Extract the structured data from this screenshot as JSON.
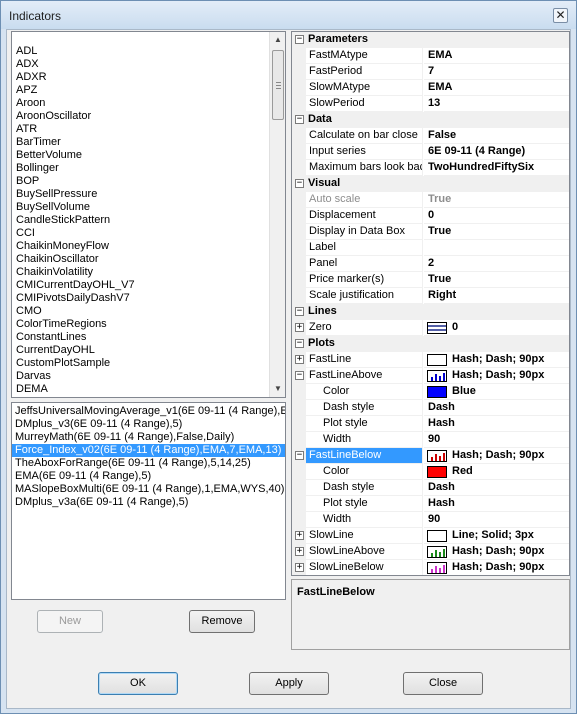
{
  "window": {
    "title": "Indicators",
    "close_glyph": "✕"
  },
  "indicators": [
    "ADL",
    "ADX",
    "ADXR",
    "APZ",
    "Aroon",
    "AroonOscillator",
    "ATR",
    "BarTimer",
    "BetterVolume",
    "Bollinger",
    "BOP",
    "BuySellPressure",
    "BuySellVolume",
    "CandleStickPattern",
    "CCI",
    "ChaikinMoneyFlow",
    "ChaikinOscillator",
    "ChaikinVolatility",
    "CMICurrentDayOHL_V7",
    "CMIPivotsDailyDashV7",
    "CMO",
    "ColorTimeRegions",
    "ConstantLines",
    "CurrentDayOHL",
    "CustomPlotSample",
    "Darvas",
    "DEMA"
  ],
  "applied": [
    "JeffsUniversalMovingAverage_v1(6E 09-11 (4 Range),E",
    "DMplus_v3(6E 09-11 (4 Range),5)",
    "MurreyMath(6E 09-11 (4 Range),False,Daily)",
    "Force_Index_v02(6E 09-11 (4 Range),EMA,7,EMA,13)",
    "TheAboxForRange(6E 09-11 (4 Range),5,14,25)",
    "EMA(6E 09-11 (4 Range),5)",
    "MASlopeBoxMulti(6E 09-11 (4 Range),1,EMA,WYS,40)",
    "DMplus_v3a(6E 09-11 (4 Range),5)"
  ],
  "applied_selected_index": 3,
  "buttons": {
    "new": "New",
    "remove": "Remove",
    "ok": "OK",
    "apply": "Apply",
    "close": "Close"
  },
  "grid": {
    "categories": {
      "parameters": "Parameters",
      "data": "Data",
      "visual": "Visual",
      "lines": "Lines",
      "plots": "Plots"
    },
    "parameters": [
      {
        "name": "FastMAtype",
        "value": "EMA"
      },
      {
        "name": "FastPeriod",
        "value": "7"
      },
      {
        "name": "SlowMAtype",
        "value": "EMA"
      },
      {
        "name": "SlowPeriod",
        "value": "13"
      }
    ],
    "data": [
      {
        "name": "Calculate on bar close",
        "value": "False"
      },
      {
        "name": "Input series",
        "value": "6E 09-11 (4 Range)"
      },
      {
        "name": "Maximum bars look bacl",
        "value": "TwoHundredFiftySix"
      }
    ],
    "visual": [
      {
        "name": "Auto scale",
        "value": "True"
      },
      {
        "name": "Displacement",
        "value": "0"
      },
      {
        "name": "Display in Data Box",
        "value": "True"
      },
      {
        "name": "Label",
        "value": ""
      },
      {
        "name": "Panel",
        "value": "2"
      },
      {
        "name": "Price marker(s)",
        "value": "True"
      },
      {
        "name": "Scale justification",
        "value": "Right"
      }
    ],
    "lines": [
      {
        "name": "Zero",
        "value": "0"
      }
    ],
    "plots": {
      "fastline": {
        "name": "FastLine",
        "value": "Hash; Dash; 90px"
      },
      "fastlineabove": {
        "name": "FastLineAbove",
        "value": "Hash; Dash; 90px",
        "color_label": "Color",
        "color_value": "Blue",
        "color_hex": "#0000ff",
        "dashstyle_label": "Dash style",
        "dashstyle_value": "Dash",
        "plotstyle_label": "Plot style",
        "plotstyle_value": "Hash",
        "width_label": "Width",
        "width_value": "90"
      },
      "fastlinebelow": {
        "name": "FastLineBelow",
        "value": "Hash; Dash; 90px",
        "color_label": "Color",
        "color_value": "Red",
        "color_hex": "#ff0000",
        "dashstyle_label": "Dash style",
        "dashstyle_value": "Dash",
        "plotstyle_label": "Plot style",
        "plotstyle_value": "Hash",
        "width_label": "Width",
        "width_value": "90"
      },
      "slowline": {
        "name": "SlowLine",
        "value": "Line; Solid; 3px"
      },
      "slowlineabove": {
        "name": "SlowLineAbove",
        "value": "Hash; Dash; 90px"
      },
      "slowlinebelow": {
        "name": "SlowLineBelow",
        "value": "Hash; Dash; 90px"
      }
    }
  },
  "description": {
    "title": "FastLineBelow"
  },
  "colors": {
    "selection": "#3399ff",
    "blue": "#0000ff",
    "red": "#ff0000",
    "green": "#1a8a1a",
    "magenta": "#cc33cc"
  }
}
